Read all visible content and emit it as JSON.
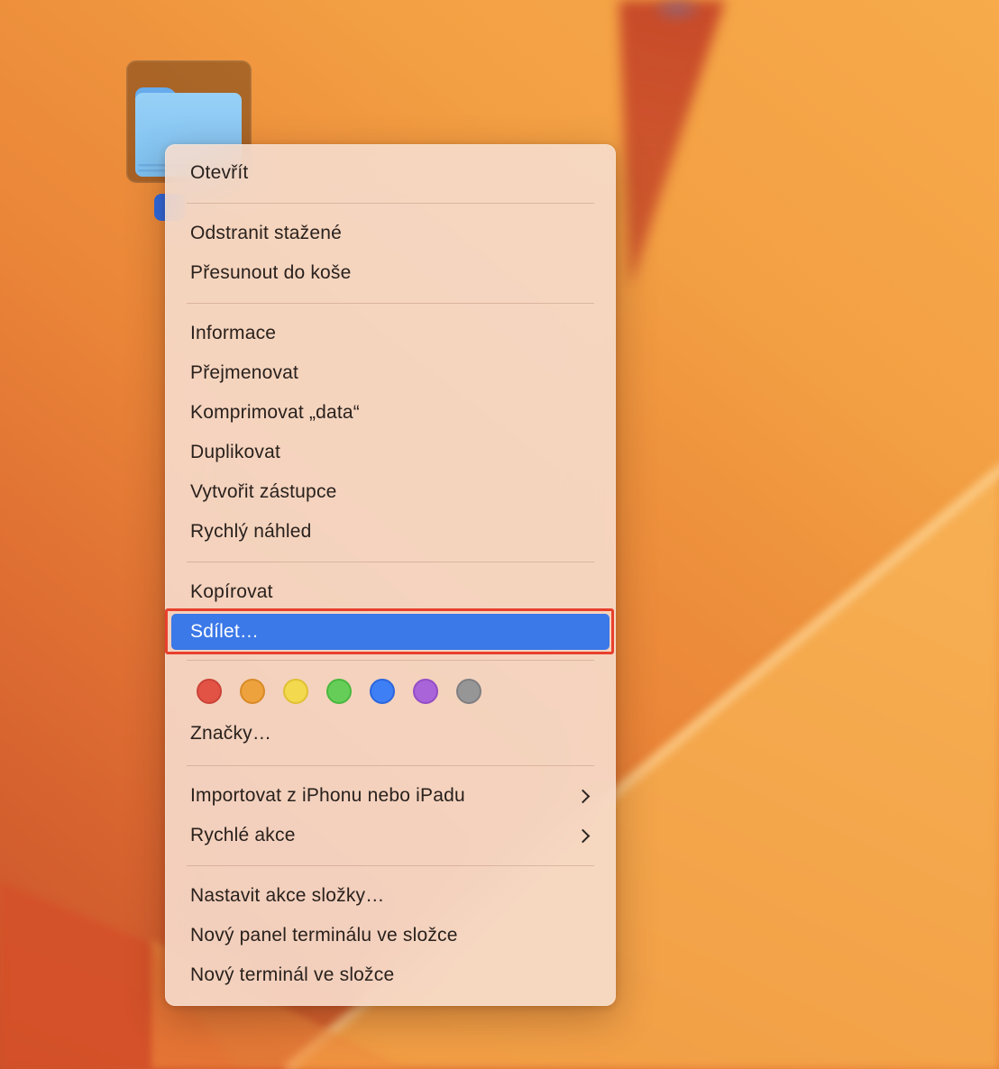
{
  "desktop": {
    "wallpaper": {
      "name": "macos-ventura-orange",
      "base_top": "#f7ab4a",
      "base_bottom_left": "#c9502a",
      "bright_field": "#f6ab4f",
      "red_wedge": "#c34026"
    },
    "folder": {
      "selection_color": "rgba(64,32,5,0.40)",
      "folder_back_color": "#66abec",
      "folder_front_color": "#8ecbf4",
      "name_pill_color": "#2c6ae3"
    }
  },
  "context_menu": {
    "highlight_color": "#3b78e8",
    "annotation_color": "#e8402d",
    "sections": [
      {
        "items": [
          {
            "label": "Otevřít"
          }
        ]
      },
      {
        "items": [
          {
            "label": "Odstranit stažené"
          },
          {
            "label": "Přesunout do koše"
          }
        ]
      },
      {
        "items": [
          {
            "label": "Informace"
          },
          {
            "label": "Přejmenovat"
          },
          {
            "label": "Komprimovat „data“"
          },
          {
            "label": "Duplikovat"
          },
          {
            "label": "Vytvořit zástupce"
          },
          {
            "label": "Rychlý náhled"
          }
        ]
      },
      {
        "items": [
          {
            "label": "Kopírovat"
          },
          {
            "label": "Sdílet…",
            "highlighted": true,
            "annotated": true
          }
        ]
      },
      {
        "tag_colors": [
          {
            "name": "red",
            "fill": "#e25345",
            "ring": "#cb4338"
          },
          {
            "name": "orange",
            "fill": "#eda23d",
            "ring": "#d98a26"
          },
          {
            "name": "yellow",
            "fill": "#f3d94e",
            "ring": "#e0c032"
          },
          {
            "name": "green",
            "fill": "#65cd58",
            "ring": "#49b83e"
          },
          {
            "name": "blue",
            "fill": "#3f7ff5",
            "ring": "#2a66dd"
          },
          {
            "name": "purple",
            "fill": "#a964d9",
            "ring": "#944dc6"
          },
          {
            "name": "gray",
            "fill": "#969697",
            "ring": "#7f7f82"
          }
        ],
        "items": [
          {
            "label": "Značky…"
          }
        ]
      },
      {
        "items": [
          {
            "label": "Importovat z iPhonu nebo iPadu",
            "submenu": true
          },
          {
            "label": "Rychlé akce",
            "submenu": true
          }
        ]
      },
      {
        "items": [
          {
            "label": "Nastavit akce složky…"
          },
          {
            "label": "Nový panel terminálu ve složce"
          },
          {
            "label": "Nový terminál ve složce"
          }
        ]
      }
    ]
  }
}
